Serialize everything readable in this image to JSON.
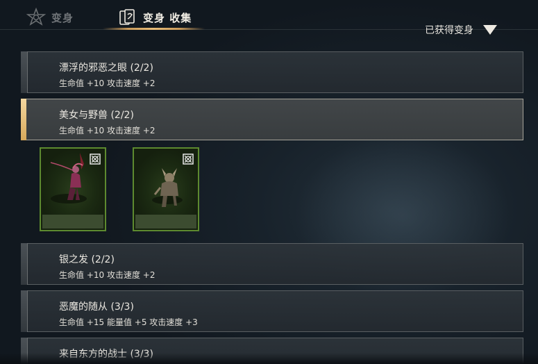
{
  "tabs": [
    {
      "label": "变身",
      "icon": "transform-star-icon",
      "active": false
    },
    {
      "label": "变身 收集",
      "icon": "collection-cards-icon",
      "active": true
    }
  ],
  "filter": {
    "label": "已获得变身",
    "icon": "dropdown-triangle-icon"
  },
  "entries": [
    {
      "name": "漂浮的邪恶之眼 (2/2)",
      "stats": "生命值 +10 攻击速度 +2",
      "selected": false
    },
    {
      "name": "美女与野兽 (2/2)",
      "stats": "生命值 +10 攻击速度 +2",
      "selected": true
    },
    {
      "name": "银之发 (2/2)",
      "stats": "生命值 +10 攻击速度 +2",
      "selected": false
    },
    {
      "name": "恶魔的随从 (3/3)",
      "stats": "生命值 +15 能量值 +5 攻击速度 +3",
      "selected": false
    },
    {
      "name": "来自东方的战士 (3/3)",
      "stats": "",
      "selected": false
    }
  ],
  "cards": [
    {
      "name": "beauty-card",
      "icon": "lock-icon"
    },
    {
      "name": "beast-card",
      "icon": "lock-icon"
    }
  ],
  "colors": {
    "accent": "#d8a95a",
    "card_border": "#5d8a2f"
  }
}
